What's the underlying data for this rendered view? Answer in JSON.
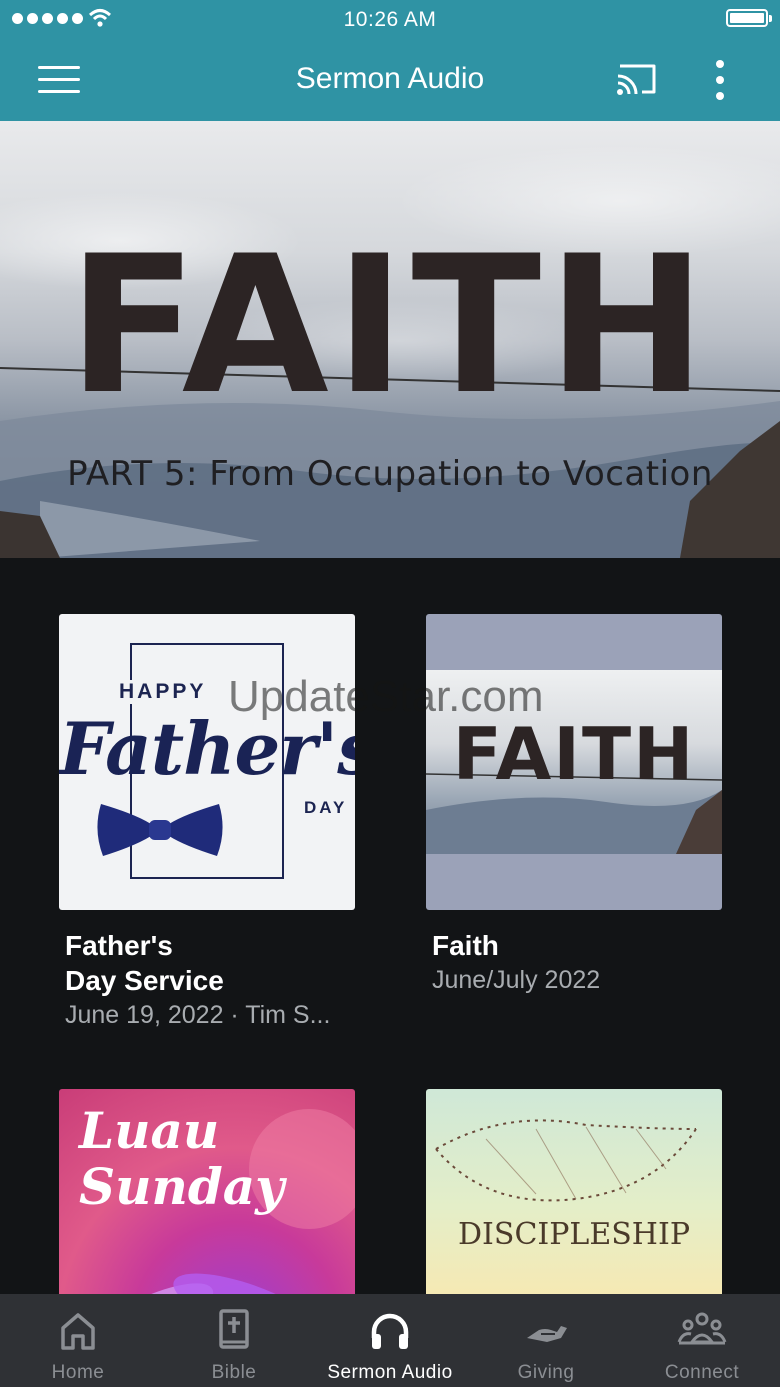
{
  "status_bar": {
    "time": "10:26 AM"
  },
  "app_bar": {
    "title": "Sermon Audio"
  },
  "hero": {
    "word": "FAITH",
    "subtitle": "PART 5: From Occupation to Vocation"
  },
  "cards": [
    {
      "title": "Father's\nDay Service",
      "subtitle": "June 19, 2022 · Tim S...",
      "art": {
        "top": "HAPPY",
        "main": "Father's",
        "bottom": "DAY"
      }
    },
    {
      "title": "Faith",
      "subtitle": "June/July 2022",
      "art": {
        "main": "FAITH"
      }
    },
    {
      "title": "",
      "subtitle": "",
      "art": {
        "main": "Luau\nSunday"
      }
    },
    {
      "title": "",
      "subtitle": "",
      "art": {
        "main": "DISCIPLESHIP"
      }
    }
  ],
  "watermark": "UpdateStar.com",
  "nav": [
    {
      "label": "Home",
      "icon": "home-icon"
    },
    {
      "label": "Bible",
      "icon": "bible-icon"
    },
    {
      "label": "Sermon Audio",
      "icon": "headphones-icon",
      "active": true
    },
    {
      "label": "Giving",
      "icon": "giving-hand-icon"
    },
    {
      "label": "Connect",
      "icon": "people-icon"
    }
  ],
  "colors": {
    "brand": "#2f93a4",
    "background": "#121416",
    "nav_bg": "#2f3135",
    "muted_text": "#a8acb0"
  }
}
